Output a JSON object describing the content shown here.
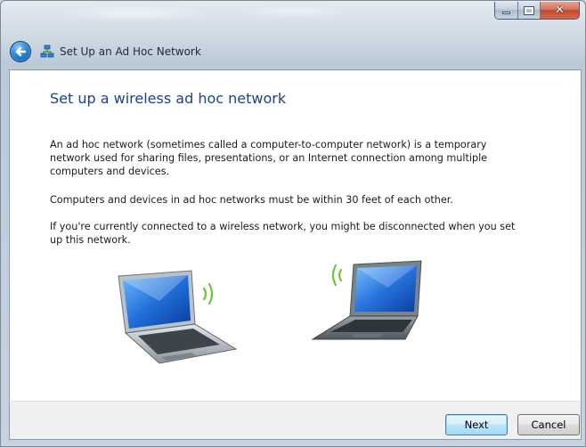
{
  "window": {
    "title": "Set Up an Ad Hoc Network"
  },
  "caption_buttons": {
    "close_glyph": "✕"
  },
  "page": {
    "heading": "Set up a wireless ad hoc network",
    "paragraphs": [
      "An ad hoc network (sometimes called a computer-to-computer network) is a temporary network used for sharing files, presentations, or an Internet connection among multiple computers and devices.",
      "Computers and devices in ad hoc networks must be within 30 feet of each other.",
      "If you're currently connected to a wireless network, you might be disconnected when you set up this network."
    ]
  },
  "footer": {
    "next_label": "Next",
    "cancel_label": "Cancel"
  },
  "icons": {
    "back": "back-arrow-icon",
    "app": "ad-hoc-network-icon",
    "illustration_left": "laptop-wireless-icon",
    "illustration_right": "laptop-wireless-icon"
  },
  "colors": {
    "heading": "#1d3f8f",
    "accent_blue": "#2a87d6",
    "wifi_green": "#6cc832",
    "close_red": "#c24a2f"
  }
}
